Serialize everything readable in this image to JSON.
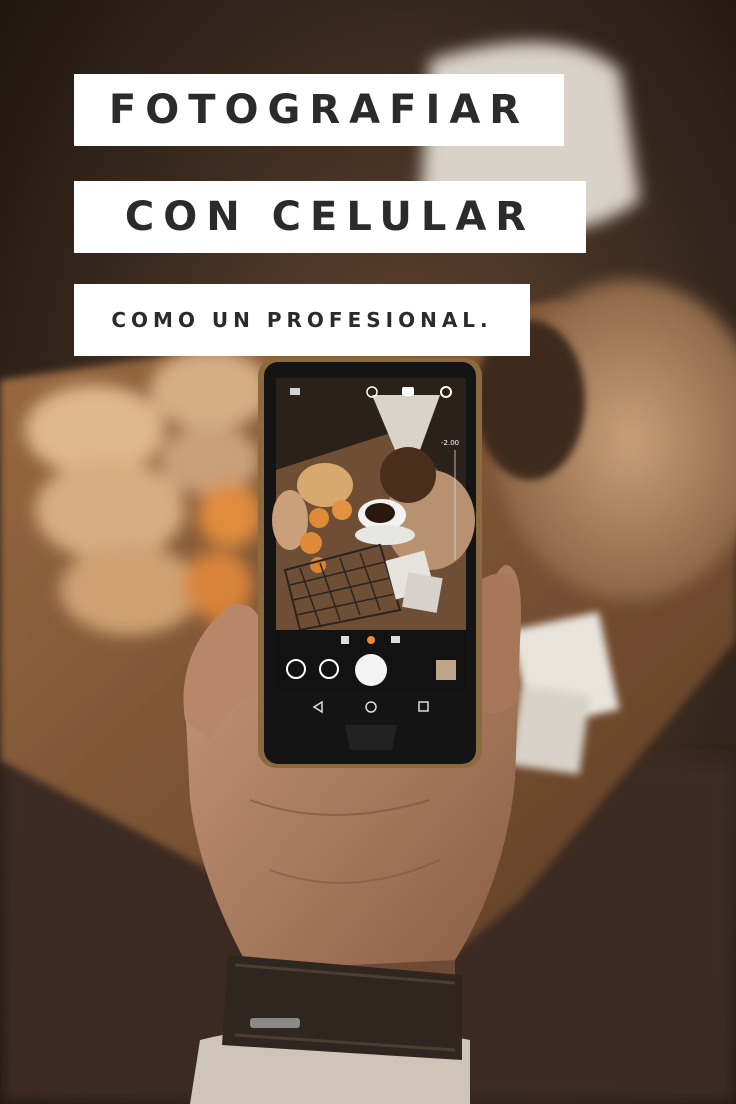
{
  "title": {
    "line1": "FOTOGRAFIAR",
    "line2": "CON CELULAR",
    "line3": "COMO UN PROFESIONAL."
  },
  "colors": {
    "banner_bg": "#ffffff",
    "banner_text": "#2b2b2b",
    "table_wood": "#8a5a36",
    "background_dark": "#2a1f18"
  },
  "icons": [
    "camera-icon",
    "gear-icon",
    "shutter-button-icon",
    "back-triangle-icon",
    "home-circle-icon",
    "recent-square-icon"
  ]
}
